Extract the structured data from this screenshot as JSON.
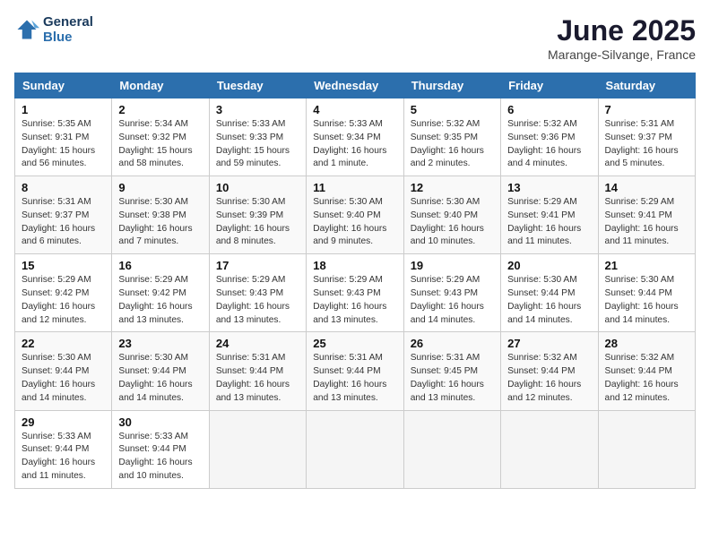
{
  "logo": {
    "line1": "General",
    "line2": "Blue"
  },
  "title": "June 2025",
  "location": "Marange-Silvange, France",
  "headers": [
    "Sunday",
    "Monday",
    "Tuesday",
    "Wednesday",
    "Thursday",
    "Friday",
    "Saturday"
  ],
  "weeks": [
    [
      {
        "num": "1",
        "info": "Sunrise: 5:35 AM\nSunset: 9:31 PM\nDaylight: 15 hours\nand 56 minutes."
      },
      {
        "num": "2",
        "info": "Sunrise: 5:34 AM\nSunset: 9:32 PM\nDaylight: 15 hours\nand 58 minutes."
      },
      {
        "num": "3",
        "info": "Sunrise: 5:33 AM\nSunset: 9:33 PM\nDaylight: 15 hours\nand 59 minutes."
      },
      {
        "num": "4",
        "info": "Sunrise: 5:33 AM\nSunset: 9:34 PM\nDaylight: 16 hours\nand 1 minute."
      },
      {
        "num": "5",
        "info": "Sunrise: 5:32 AM\nSunset: 9:35 PM\nDaylight: 16 hours\nand 2 minutes."
      },
      {
        "num": "6",
        "info": "Sunrise: 5:32 AM\nSunset: 9:36 PM\nDaylight: 16 hours\nand 4 minutes."
      },
      {
        "num": "7",
        "info": "Sunrise: 5:31 AM\nSunset: 9:37 PM\nDaylight: 16 hours\nand 5 minutes."
      }
    ],
    [
      {
        "num": "8",
        "info": "Sunrise: 5:31 AM\nSunset: 9:37 PM\nDaylight: 16 hours\nand 6 minutes."
      },
      {
        "num": "9",
        "info": "Sunrise: 5:30 AM\nSunset: 9:38 PM\nDaylight: 16 hours\nand 7 minutes."
      },
      {
        "num": "10",
        "info": "Sunrise: 5:30 AM\nSunset: 9:39 PM\nDaylight: 16 hours\nand 8 minutes."
      },
      {
        "num": "11",
        "info": "Sunrise: 5:30 AM\nSunset: 9:40 PM\nDaylight: 16 hours\nand 9 minutes."
      },
      {
        "num": "12",
        "info": "Sunrise: 5:30 AM\nSunset: 9:40 PM\nDaylight: 16 hours\nand 10 minutes."
      },
      {
        "num": "13",
        "info": "Sunrise: 5:29 AM\nSunset: 9:41 PM\nDaylight: 16 hours\nand 11 minutes."
      },
      {
        "num": "14",
        "info": "Sunrise: 5:29 AM\nSunset: 9:41 PM\nDaylight: 16 hours\nand 11 minutes."
      }
    ],
    [
      {
        "num": "15",
        "info": "Sunrise: 5:29 AM\nSunset: 9:42 PM\nDaylight: 16 hours\nand 12 minutes."
      },
      {
        "num": "16",
        "info": "Sunrise: 5:29 AM\nSunset: 9:42 PM\nDaylight: 16 hours\nand 13 minutes."
      },
      {
        "num": "17",
        "info": "Sunrise: 5:29 AM\nSunset: 9:43 PM\nDaylight: 16 hours\nand 13 minutes."
      },
      {
        "num": "18",
        "info": "Sunrise: 5:29 AM\nSunset: 9:43 PM\nDaylight: 16 hours\nand 13 minutes."
      },
      {
        "num": "19",
        "info": "Sunrise: 5:29 AM\nSunset: 9:43 PM\nDaylight: 16 hours\nand 14 minutes."
      },
      {
        "num": "20",
        "info": "Sunrise: 5:30 AM\nSunset: 9:44 PM\nDaylight: 16 hours\nand 14 minutes."
      },
      {
        "num": "21",
        "info": "Sunrise: 5:30 AM\nSunset: 9:44 PM\nDaylight: 16 hours\nand 14 minutes."
      }
    ],
    [
      {
        "num": "22",
        "info": "Sunrise: 5:30 AM\nSunset: 9:44 PM\nDaylight: 16 hours\nand 14 minutes."
      },
      {
        "num": "23",
        "info": "Sunrise: 5:30 AM\nSunset: 9:44 PM\nDaylight: 16 hours\nand 14 minutes."
      },
      {
        "num": "24",
        "info": "Sunrise: 5:31 AM\nSunset: 9:44 PM\nDaylight: 16 hours\nand 13 minutes."
      },
      {
        "num": "25",
        "info": "Sunrise: 5:31 AM\nSunset: 9:44 PM\nDaylight: 16 hours\nand 13 minutes."
      },
      {
        "num": "26",
        "info": "Sunrise: 5:31 AM\nSunset: 9:45 PM\nDaylight: 16 hours\nand 13 minutes."
      },
      {
        "num": "27",
        "info": "Sunrise: 5:32 AM\nSunset: 9:44 PM\nDaylight: 16 hours\nand 12 minutes."
      },
      {
        "num": "28",
        "info": "Sunrise: 5:32 AM\nSunset: 9:44 PM\nDaylight: 16 hours\nand 12 minutes."
      }
    ],
    [
      {
        "num": "29",
        "info": "Sunrise: 5:33 AM\nSunset: 9:44 PM\nDaylight: 16 hours\nand 11 minutes."
      },
      {
        "num": "30",
        "info": "Sunrise: 5:33 AM\nSunset: 9:44 PM\nDaylight: 16 hours\nand 10 minutes."
      },
      {
        "num": "",
        "info": ""
      },
      {
        "num": "",
        "info": ""
      },
      {
        "num": "",
        "info": ""
      },
      {
        "num": "",
        "info": ""
      },
      {
        "num": "",
        "info": ""
      }
    ]
  ]
}
